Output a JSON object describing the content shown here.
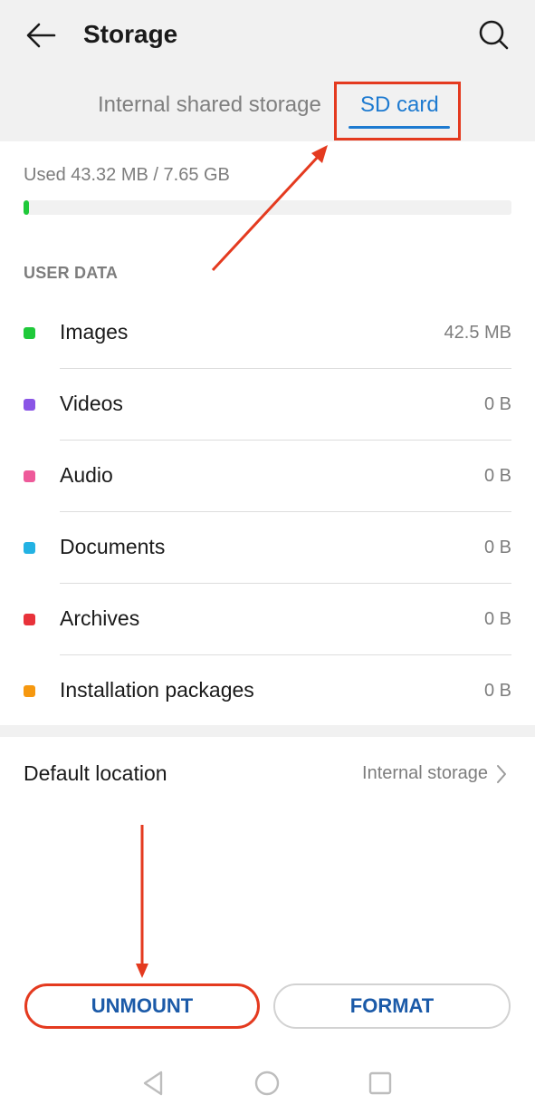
{
  "header": {
    "title": "Storage",
    "back_icon": "arrow-left-icon",
    "search_icon": "search-icon"
  },
  "tabs": [
    {
      "label": "Internal shared storage",
      "selected": false
    },
    {
      "label": "SD card",
      "selected": true
    }
  ],
  "colors": {
    "accent": "#1d7ad0",
    "annotation": "#e43a1f",
    "button_text": "#1b5aa8"
  },
  "storage": {
    "used_text": "Used 43.32 MB / 7.65 GB",
    "used_fraction": 0.0055
  },
  "user_data": {
    "section_label": "USER DATA",
    "items": [
      {
        "label": "Images",
        "size": "42.5 MB",
        "color": "#1fc93a"
      },
      {
        "label": "Videos",
        "size": "0 B",
        "color": "#8a55e6"
      },
      {
        "label": "Audio",
        "size": "0 B",
        "color": "#ee5a9a"
      },
      {
        "label": "Documents",
        "size": "0 B",
        "color": "#23b2e3"
      },
      {
        "label": "Archives",
        "size": "0 B",
        "color": "#e8323a"
      },
      {
        "label": "Installation packages",
        "size": "0 B",
        "color": "#f6980f"
      }
    ]
  },
  "default_location": {
    "label": "Default location",
    "value": "Internal storage"
  },
  "actions": {
    "unmount_label": "UNMOUNT",
    "format_label": "FORMAT"
  },
  "navbar": {
    "back_icon": "nav-back-icon",
    "home_icon": "nav-home-icon",
    "recent_icon": "nav-recent-icon"
  }
}
